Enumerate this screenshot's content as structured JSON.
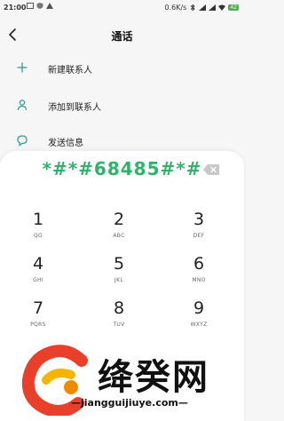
{
  "status_bar": {
    "time": "21:00",
    "network_speed": "0.6K/s",
    "battery": "42"
  },
  "header": {
    "title": "通话"
  },
  "menu": [
    {
      "label": "新建联系人",
      "icon": "plus-icon"
    },
    {
      "label": "添加到联系人",
      "icon": "person-icon"
    },
    {
      "label": "发送信息",
      "icon": "message-bubble-icon"
    }
  ],
  "dialpad": {
    "input": "*#*#68485#*#",
    "keys": [
      {
        "digit": "1",
        "letters": "QO"
      },
      {
        "digit": "2",
        "letters": "ABC"
      },
      {
        "digit": "3",
        "letters": "DEF"
      },
      {
        "digit": "4",
        "letters": "GHI"
      },
      {
        "digit": "5",
        "letters": "JKL"
      },
      {
        "digit": "6",
        "letters": "MNO"
      },
      {
        "digit": "7",
        "letters": "PQRS"
      },
      {
        "digit": "8",
        "letters": "TUV"
      },
      {
        "digit": "9",
        "letters": "WXYZ"
      }
    ]
  },
  "watermark": {
    "text": "绛癸网",
    "url": "—jiangguijiuye.com—"
  },
  "colors": {
    "accent": "#2db36a",
    "background": "#f6f6f6",
    "pad_background": "#ffffff"
  }
}
